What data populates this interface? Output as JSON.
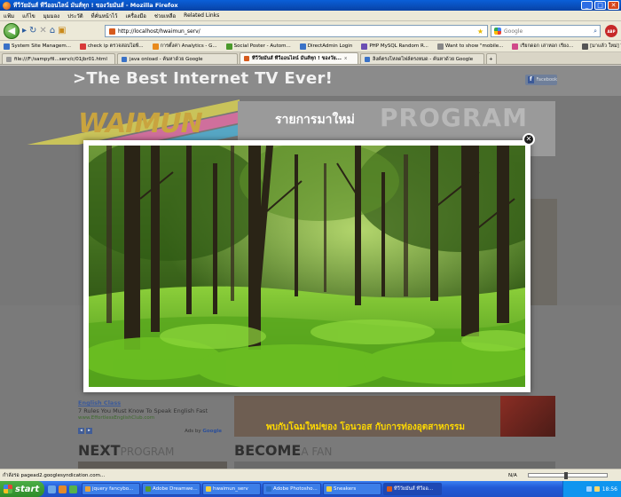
{
  "window": {
    "title": "ทีวีวัยมันส์ ทีวีออนไลน์ มันส์ทุก ! ของวัยมันส์ - Mozilla Firefox",
    "minimize": "_",
    "maximize": "□",
    "close": "✕"
  },
  "menu": [
    "แฟ้ม",
    "แก้ไข",
    "มุมมอง",
    "ประวัติ",
    "ที่คั่นหน้าไว้",
    "เครื่องมือ",
    "ช่วยเหลือ",
    "Related Links"
  ],
  "nav": {
    "url": "http://localhost/hwaimun_serv/",
    "search_placeholder": "Google",
    "adblock": "ABP"
  },
  "bookmarks": [
    {
      "label": "System Site Managem...",
      "color": "#3a72c7"
    },
    {
      "label": "check ip ตรวจสอบไอพี...",
      "color": "#d83a3a"
    },
    {
      "label": "การตั้งค่า Analytics - G...",
      "color": "#e88a1d"
    },
    {
      "label": "Social Poster - Autom...",
      "color": "#4a9a2b"
    },
    {
      "label": "DirectAdmin Login",
      "color": "#3a72c7"
    },
    {
      "label": "PHP MySQL Random R...",
      "color": "#6b4fb3"
    },
    {
      "label": "Want to show \"mobile...",
      "color": "#888888"
    },
    {
      "label": "เรียกดอก เล่าหอก เรียง...",
      "color": "#d04a8a"
    },
    {
      "label": "[มาแล้ว ใหม่] The N...",
      "color": "#555555"
    }
  ],
  "tabs": [
    {
      "label": "file:///F:/sampyfil...serv/c/01jbr01.html",
      "color": "#999999",
      "active": false
    },
    {
      "label": "java onload - ค้นหาด้วย Google",
      "color": "#3a72c7",
      "active": false
    },
    {
      "label": "ทีวีวัยมันส์ ทีวีออนไลน์ มันส์ทุก ! ของวัย...",
      "color": "#d65a1c",
      "active": true
    },
    {
      "label": "ลิงค์ตรงโหลดไฟล์ตรงหมด - ค้นหาด้วย Google",
      "color": "#3a72c7",
      "active": false
    }
  ],
  "tab_close": "x",
  "page": {
    "tagline": ">The Best Internet TV Ever!",
    "facebook_label": "Facebook",
    "logo": "WAIMUN",
    "program_thai": "รายการมาใหม่",
    "program_en": "PROGRAM",
    "ad": {
      "title": "English Class",
      "desc": "7 Rules You Must Know To Speak English Fast",
      "url": "www.EffortlessEnglishClub.com",
      "adsby": "Ads by",
      "google": "Google"
    },
    "promo_text": "พบกับโฉมใหม่ของ โอนวอส กับการท่องอุตสาหกรรม",
    "next_bold": "NEXT",
    "next_light": "PROGRAM",
    "become_bold": "BECOME",
    "become_light": "A FAN"
  },
  "lightbox": {
    "close": "✕"
  },
  "status": {
    "text": "กำลังรอ pagead2.googlesyndication.com...",
    "na": "N/A"
  },
  "taskbar": {
    "start": "start",
    "tasks": [
      {
        "label": "jquery fancybo...",
        "color": "#e6a23c",
        "active": false
      },
      {
        "label": "Adobe Dreamwe...",
        "color": "#5a9a2e",
        "active": false
      },
      {
        "label": "hwaimun_serv",
        "color": "#f0d040",
        "active": false
      },
      {
        "label": "Adobe Photosho...",
        "color": "#2a6ec9",
        "active": false
      },
      {
        "label": "Sneakers",
        "color": "#f0d040",
        "active": false
      },
      {
        "label": "ทีวีวัยมันส์ ทีวีออ...",
        "color": "#d65a1c",
        "active": true
      }
    ],
    "clock": "18:56"
  }
}
